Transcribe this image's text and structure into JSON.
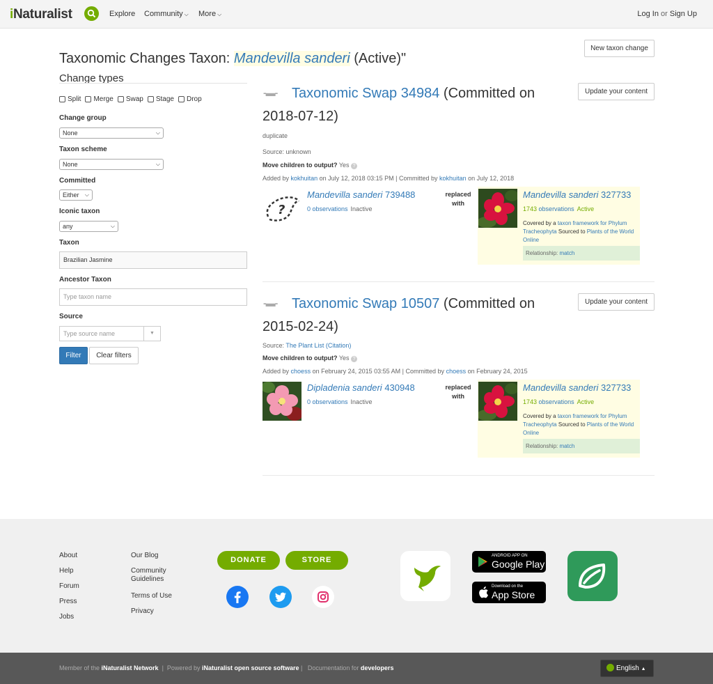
{
  "header": {
    "logo_i": "i",
    "logo_rest": "Naturalist",
    "nav": [
      "Explore",
      "Community",
      "More"
    ],
    "login": "Log In",
    "or": "or",
    "signup": "Sign Up"
  },
  "page": {
    "title_prefix": "Taxonomic Changes Taxon:",
    "title_taxon": "Mandevilla sanderi",
    "title_suffix": "(Active)\"",
    "new_change_button": "New taxon change"
  },
  "filters": {
    "heading": "Change types",
    "types": [
      "Split",
      "Merge",
      "Swap",
      "Stage",
      "Drop"
    ],
    "change_group_label": "Change group",
    "change_group_value": "None",
    "taxon_scheme_label": "Taxon scheme",
    "taxon_scheme_value": "None",
    "committed_label": "Committed",
    "committed_value": "Either",
    "iconic_label": "Iconic taxon",
    "iconic_value": "any",
    "taxon_label": "Taxon",
    "taxon_value": "Brazilian Jasmine",
    "ancestor_label": "Ancestor Taxon",
    "ancestor_placeholder": "Type taxon name",
    "source_label": "Source",
    "source_placeholder": "Type source name",
    "filter_button": "Filter",
    "clear_button": "Clear filters"
  },
  "changes": [
    {
      "link": "Taxonomic Swap 34984",
      "committed_line1": "(Committed on",
      "committed_line2": "2018-07-12)",
      "update_button": "Update your content",
      "description": "duplicate",
      "source_label": "Source:",
      "source_value": "unknown",
      "move_label": "Move children to output?",
      "move_value": "Yes",
      "added_by_label": "Added by",
      "added_by_user": "kokhuitan",
      "added_on": "on July 12, 2018 03:15 PM | Committed by",
      "committed_by_user": "kokhuitan",
      "committed_on": "on July 12, 2018",
      "input_name": "Mandevilla sanderi",
      "input_id": "739488",
      "input_obs": "0 observations",
      "input_status": "Inactive",
      "replaced_with": [
        "replaced",
        "with"
      ],
      "output_name": "Mandevilla sanderi",
      "output_id": "327733",
      "output_obs_count": "1743",
      "output_obs_label": "observations",
      "output_status": "Active",
      "covered_pre": "Covered by a",
      "covered_link": "taxon framework for Phylum Tracheophyta",
      "sourced_pre": "Sourced to",
      "sourced_link": "Plants of the World Online",
      "relationship_label": "Relationship:",
      "relationship_value": "match"
    },
    {
      "link": "Taxonomic Swap 10507",
      "committed_line1": "(Committed on",
      "committed_line2": "2015-02-24)",
      "update_button": "Update your content",
      "source_label": "Source:",
      "source_value": "The Plant List",
      "source_citation": "(Citation)",
      "move_label": "Move children to output?",
      "move_value": "Yes",
      "added_by_label": "Added by",
      "added_by_user": "choess",
      "added_on": "on February 24, 2015 03:55 AM | Committed by",
      "committed_by_user": "choess",
      "committed_on": "on February 24, 2015",
      "input_name": "Dipladenia sanderi",
      "input_id": "430948",
      "input_obs": "0 observations",
      "input_status": "Inactive",
      "replaced_with": [
        "replaced",
        "with"
      ],
      "output_name": "Mandevilla sanderi",
      "output_id": "327733",
      "output_obs_count": "1743",
      "output_obs_label": "observations",
      "output_status": "Active",
      "covered_pre": "Covered by a",
      "covered_link": "taxon framework for Phylum Tracheophyta",
      "sourced_pre": "Sourced to",
      "sourced_link": "Plants of the World Online",
      "relationship_label": "Relationship:",
      "relationship_value": "match"
    }
  ],
  "footer": {
    "col1": [
      "About",
      "Help",
      "Forum",
      "Press",
      "Jobs"
    ],
    "col2": [
      "Our Blog",
      "Community Guidelines",
      "Terms of Use",
      "Privacy"
    ],
    "donate": "DONATE",
    "store": "STORE",
    "google_small": "ANDROID APP ON",
    "google_big": "Google Play",
    "apple_small": "Download on the",
    "apple_big": "App Store"
  },
  "bottombar": {
    "member_pre": "Member of the",
    "network": "iNaturalist Network",
    "powered_pre": "Powered by",
    "software": "iNaturalist open source software",
    "doc_pre": "Documentation for",
    "developers": "developers",
    "language": "English"
  }
}
